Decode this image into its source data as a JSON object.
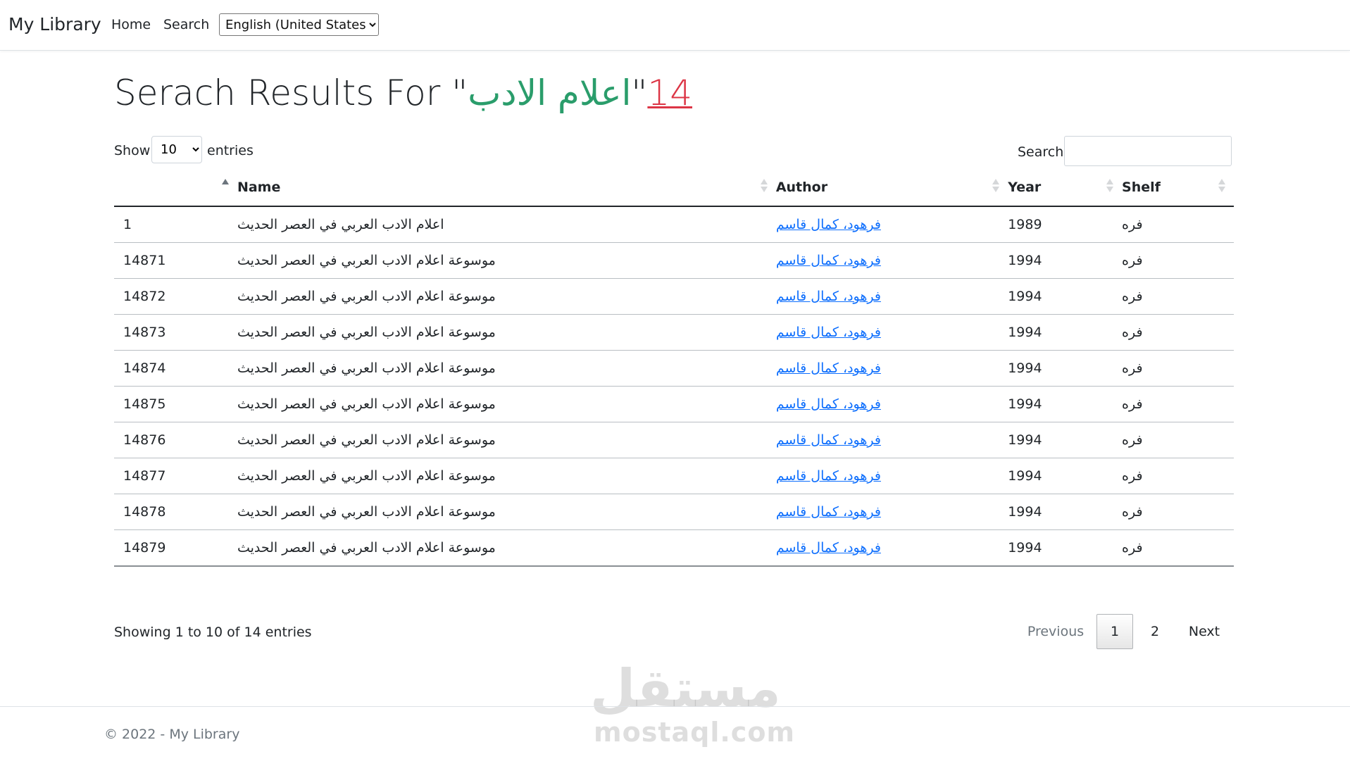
{
  "navbar": {
    "brand": "My Library",
    "links": [
      "Home",
      "Search"
    ],
    "language": {
      "selected": "English (United States)"
    }
  },
  "heading": {
    "prefix": "Serach Results For \"",
    "query": "اعلام الادب",
    "quote": "\"",
    "count": "14"
  },
  "controls": {
    "show_label": "Show",
    "length_selected": "10",
    "entries_label": "entries",
    "search_label": "Search:",
    "search_value": ""
  },
  "table": {
    "columns": [
      "",
      "Name",
      "Author",
      "Year",
      "Shelf"
    ],
    "rows": [
      {
        "id": "1",
        "name": "اعلام الادب العربي في العصر الحديث",
        "author": "فرهود، كمال قاسم",
        "year": "1989",
        "shelf": "فره"
      },
      {
        "id": "14871",
        "name": "موسوعة اعلام الادب العربي في العصر الحديث",
        "author": "فرهود، كمال قاسم",
        "year": "1994",
        "shelf": "فره"
      },
      {
        "id": "14872",
        "name": "موسوعة اعلام الادب العربي في العصر الحديث",
        "author": "فرهود، كمال قاسم",
        "year": "1994",
        "shelf": "فره"
      },
      {
        "id": "14873",
        "name": "موسوعة اعلام الادب العربي في العصر الحديث",
        "author": "فرهود، كمال قاسم",
        "year": "1994",
        "shelf": "فره"
      },
      {
        "id": "14874",
        "name": "موسوعة اعلام الادب العربي في العصر الحديث",
        "author": "فرهود، كمال قاسم",
        "year": "1994",
        "shelf": "فره"
      },
      {
        "id": "14875",
        "name": "موسوعة اعلام الادب العربي في العصر الحديث",
        "author": "فرهود، كمال قاسم",
        "year": "1994",
        "shelf": "فره"
      },
      {
        "id": "14876",
        "name": "موسوعة اعلام الادب العربي في العصر الحديث",
        "author": "فرهود، كمال قاسم",
        "year": "1994",
        "shelf": "فره"
      },
      {
        "id": "14877",
        "name": "موسوعة اعلام الادب العربي في العصر الحديث",
        "author": "فرهود، كمال قاسم",
        "year": "1994",
        "shelf": "فره"
      },
      {
        "id": "14878",
        "name": "موسوعة اعلام الادب العربي في العصر الحديث",
        "author": "فرهود، كمال قاسم",
        "year": "1994",
        "shelf": "فره"
      },
      {
        "id": "14879",
        "name": "موسوعة اعلام الادب العربي في العصر الحديث",
        "author": "فرهود، كمال قاسم",
        "year": "1994",
        "shelf": "فره"
      }
    ]
  },
  "pagination": {
    "info": "Showing 1 to 10 of 14 entries",
    "previous": "Previous",
    "pages": [
      "1",
      "2"
    ],
    "current": "1",
    "next": "Next"
  },
  "footer": {
    "copyright": "© 2022 - My Library"
  },
  "watermark": {
    "logo": "مستقل",
    "text": "mostaql.com"
  },
  "colors": {
    "query": "#2a9d6b",
    "count": "#dc3545",
    "link": "#0d6efd"
  }
}
